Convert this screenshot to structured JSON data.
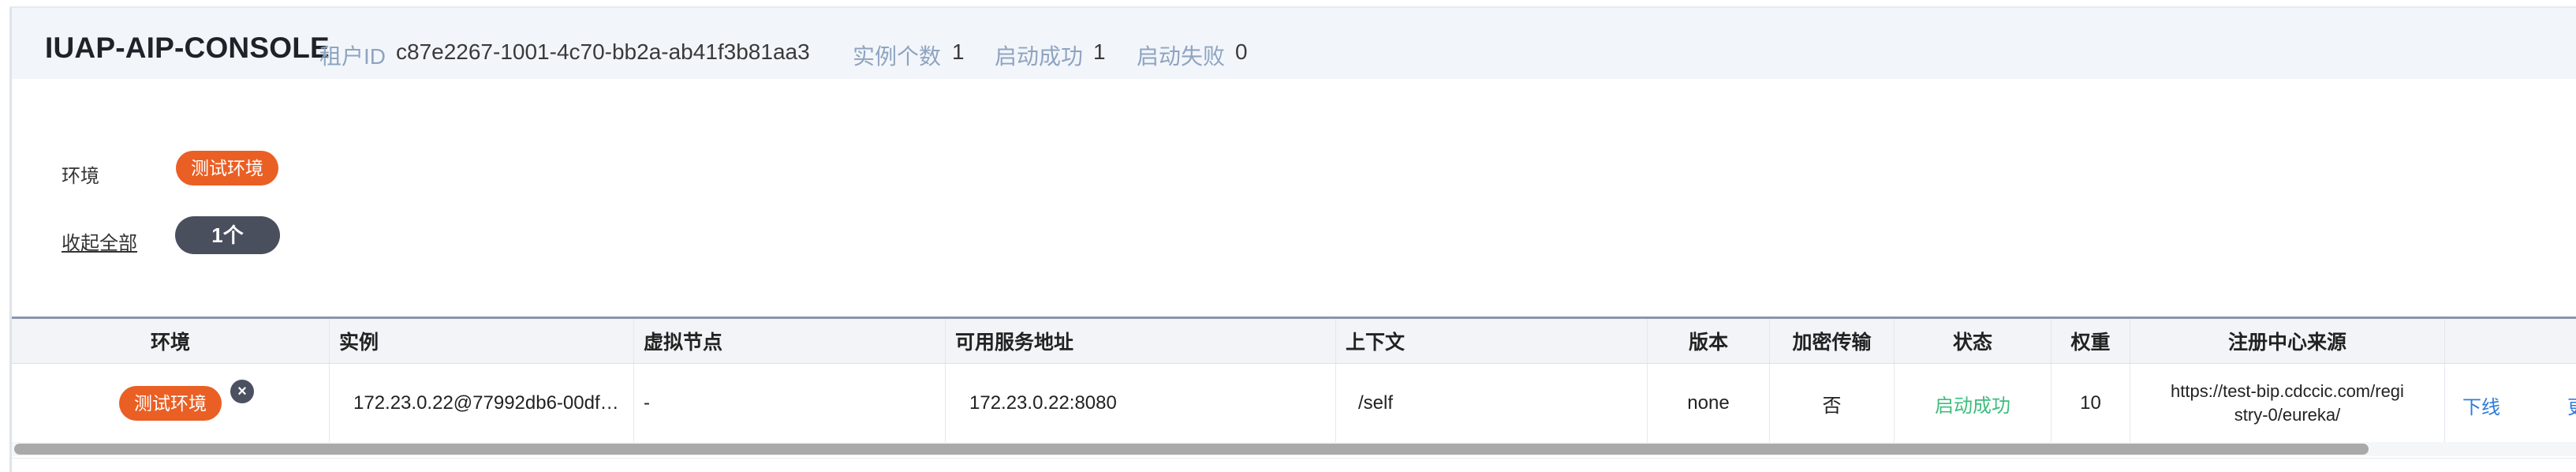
{
  "header": {
    "title": "IUAP-AIP-CONSOLE",
    "tenant_label": "租户ID",
    "tenant_id": "c87e2267-1001-4c70-bb2a-ab41f3b81aa3",
    "instance_count_label": "实例个数",
    "instance_count": "1",
    "start_success_label": "启动成功",
    "start_success_count": "1",
    "start_fail_label": "启动失败",
    "start_fail_count": "0"
  },
  "filters": {
    "env_label": "环境",
    "env_tag": "测试环境",
    "collapse_all": "收起全部",
    "count_pill": "1个"
  },
  "table": {
    "columns": [
      "环境",
      "实例",
      "虚拟节点",
      "可用服务地址",
      "上下文",
      "版本",
      "加密传输",
      "状态",
      "权重",
      "注册中心来源"
    ],
    "row": {
      "env": "测试环境",
      "close_icon": "×",
      "instance": "172.23.0.22@77992db6-00df…",
      "virtual_node": "-",
      "service_address": "172.23.0.22:8080",
      "context": "/self",
      "version": "none",
      "encrypted": "否",
      "status": "启动成功",
      "weight": "10",
      "registry_line1": "https://test-bip.cdccic.com/regi",
      "registry_line2": "stry-0/eureka/",
      "action_offline": "下线",
      "action_more": "更"
    }
  },
  "colors": {
    "env_tag": "#ea5f24",
    "status_success": "#3dbd7d",
    "link": "#2f7bd9",
    "header_bg": "#f2f6fb",
    "muted_label": "#8fa4c0"
  },
  "icons": {
    "close": "close-icon"
  }
}
